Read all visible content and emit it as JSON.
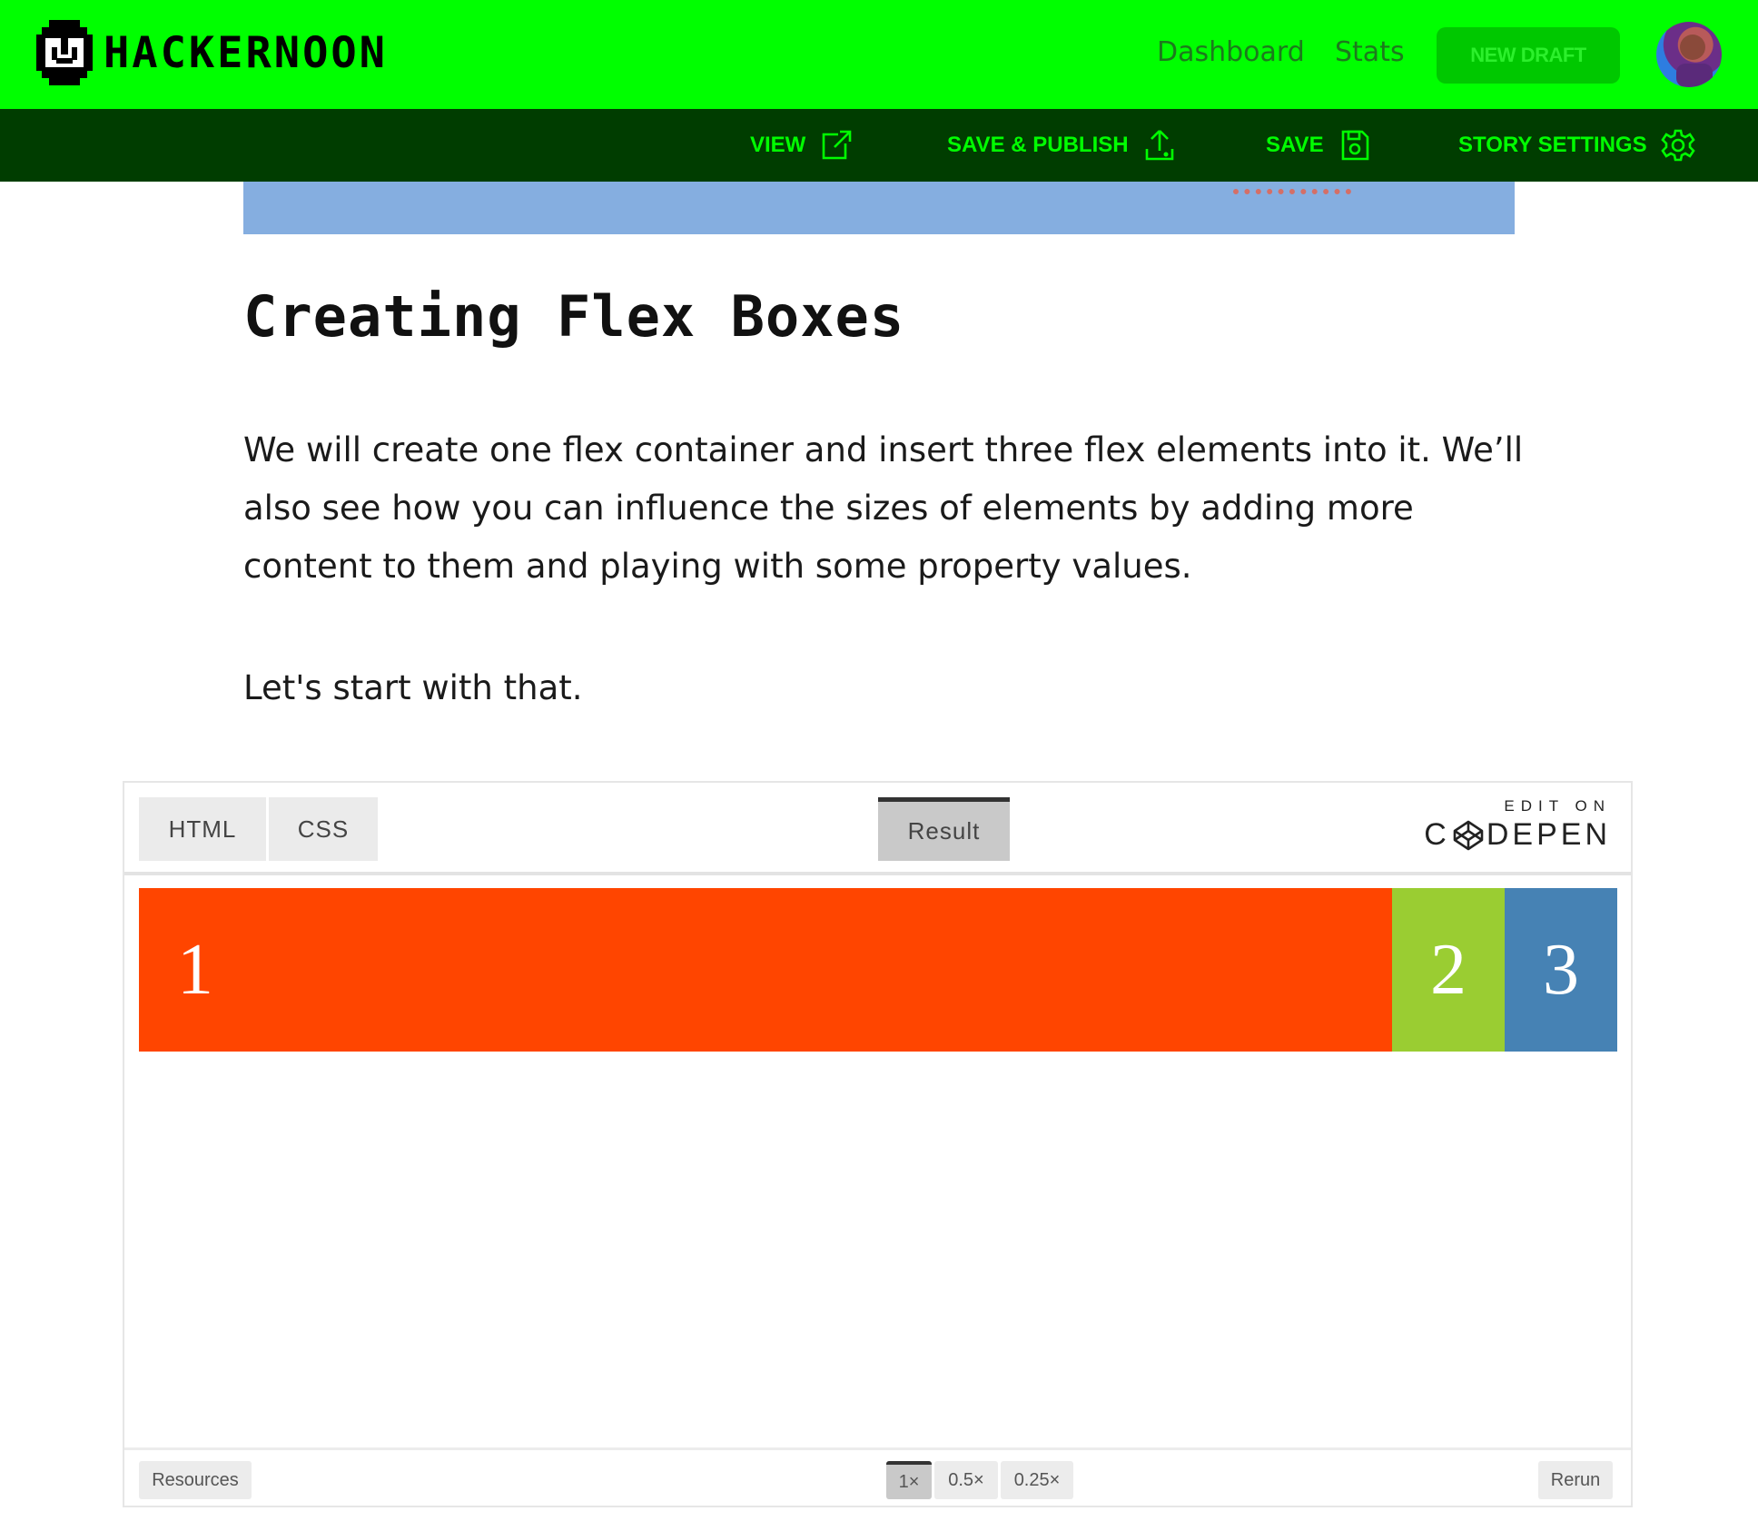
{
  "app": {
    "brand": "HACKERNOON",
    "accent_color": "#00ff00",
    "actionbar_color": "#003d00"
  },
  "header": {
    "nav": {
      "dashboard": "Dashboard",
      "stats": "Stats"
    },
    "new_draft": "NEW DRAFT",
    "avatar_icon": "user-avatar"
  },
  "actionbar": {
    "view": {
      "label": "VIEW",
      "icon": "external-link-icon"
    },
    "save_publish": {
      "label": "SAVE & PUBLISH",
      "icon": "upload-icon"
    },
    "save": {
      "label": "SAVE",
      "icon": "floppy-disk-icon"
    },
    "story_settings": {
      "label": "STORY SETTINGS",
      "icon": "gear-icon"
    }
  },
  "article": {
    "heading": "Creating Flex Boxes",
    "paragraphs": [
      "We will create one flex container and insert three flex elements into it. We’ll also see how you can influence the sizes of elements by adding more content to them and playing with some property values.",
      "Let's start with that."
    ]
  },
  "codepen": {
    "tabs": [
      "HTML",
      "CSS"
    ],
    "active_tab": "Result",
    "brand_top": "EDIT ON",
    "brand_name_start": "C",
    "brand_name_end": "DEPEN",
    "flex_items": [
      {
        "label": "1",
        "color": "#ff4500"
      },
      {
        "label": "2",
        "color": "#9acd32"
      },
      {
        "label": "3",
        "color": "#4682b4"
      }
    ],
    "footer": {
      "resources": "Resources",
      "zoom_options": [
        "1×",
        "0.5×",
        "0.25×"
      ],
      "active_zoom": "1×",
      "rerun": "Rerun"
    }
  }
}
